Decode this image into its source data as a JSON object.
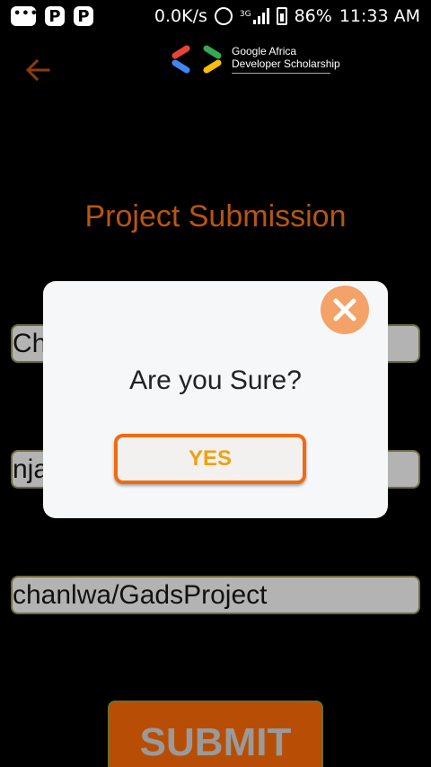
{
  "status_bar": {
    "net_speed": "0.0K/s",
    "network_type": "3G",
    "battery": "86%",
    "time": "11:33 AM",
    "icons": [
      "message-icon",
      "p-app-icon",
      "p-app-icon",
      "alarm-icon",
      "signal-icon",
      "battery-icon"
    ]
  },
  "header": {
    "logo_line1": "Google Africa",
    "logo_line2": "Developer Scholarship",
    "logo_colors": [
      "#ea4335",
      "#4285f4",
      "#34a853",
      "#fbbc05"
    ]
  },
  "page_title": "Project Submission",
  "fields": [
    {
      "value": "Ch"
    },
    {
      "value": "nja"
    },
    {
      "value": "chanlwa/GadsProject"
    }
  ],
  "submit_label": "SUBMIT",
  "dialog": {
    "message": "Are you Sure?",
    "confirm_label": "YES"
  },
  "colors": {
    "accent": "#b85512",
    "dialog_close": "#f4a267",
    "yes_border": "#f06b10",
    "yes_text": "#f0a010"
  }
}
